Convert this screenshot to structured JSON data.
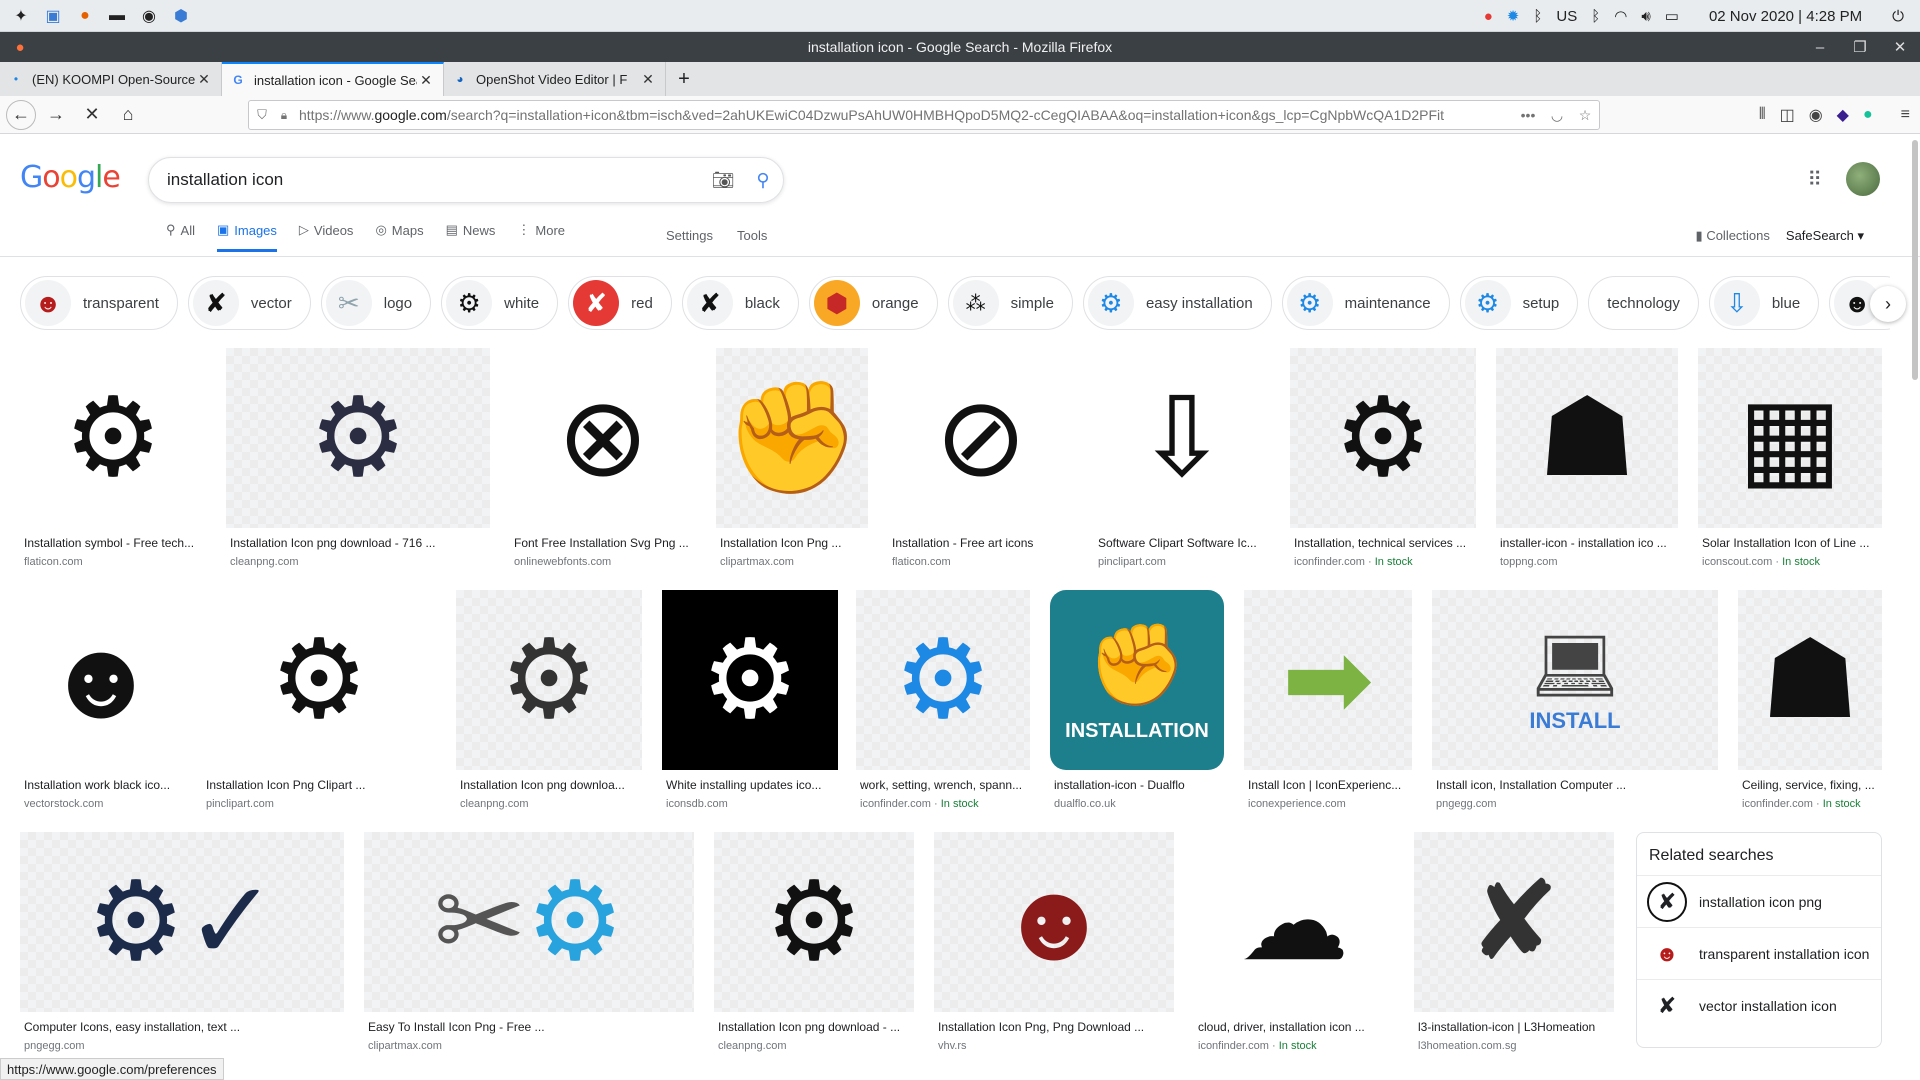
{
  "os": {
    "keyboard": "US",
    "datetime": "02 Nov 2020 | 4:28 PM"
  },
  "window": {
    "title": "installation icon - Google Search - Mozilla Firefox"
  },
  "tabs": [
    {
      "title": "(EN) KOOMPI Open-Source",
      "close": "✕"
    },
    {
      "title": "installation icon - Google Search",
      "close": "✕"
    },
    {
      "title": "OpenShot Video Editor | F",
      "close": "✕"
    }
  ],
  "url": {
    "prefix": "https://www.",
    "domain": "google.com",
    "rest": "/search?q=installation+icon&tbm=isch&ved=2ahUKEwiC04DzwuPsAhUW0HMBHQpoD5MQ2-cCegQIABAA&oq=installation+icon&gs_lcp=CgNpbWcQA1D2PFit"
  },
  "google": {
    "logo": [
      "G",
      "o",
      "o",
      "g",
      "l",
      "e"
    ],
    "logo_colors": [
      "#4285f4",
      "#ea4335",
      "#fbbc05",
      "#4285f4",
      "#34a853",
      "#ea4335"
    ],
    "query": "installation icon",
    "nav": [
      "All",
      "Images",
      "Videos",
      "Maps",
      "News",
      "More"
    ],
    "settings": "Settings",
    "tools": "Tools",
    "collections": "Collections",
    "safesearch": "SafeSearch"
  },
  "chips": [
    {
      "label": "transparent",
      "icon": "worker-icon"
    },
    {
      "label": "vector",
      "icon": "tools-icon"
    },
    {
      "label": "logo",
      "icon": "tools-icon"
    },
    {
      "label": "white",
      "icon": "gear-icon"
    },
    {
      "label": "red",
      "icon": "tools-icon"
    },
    {
      "label": "black",
      "icon": "tools-icon"
    },
    {
      "label": "orange",
      "icon": "box-icon"
    },
    {
      "label": "simple",
      "icon": "grid-icon"
    },
    {
      "label": "easy installation",
      "icon": "gear-icon"
    },
    {
      "label": "maintenance",
      "icon": "gear-icon"
    },
    {
      "label": "setup",
      "icon": "gear-icon"
    },
    {
      "label": "technology",
      "icon": ""
    },
    {
      "label": "blue",
      "icon": "download-icon"
    }
  ],
  "results_row1": [
    {
      "caption": "Installation symbol - Free tech...",
      "source": "flaticon.com",
      "stock": ""
    },
    {
      "caption": "Installation Icon png download - 716 ...",
      "source": "cleanpng.com",
      "stock": ""
    },
    {
      "caption": "Font Free Installation Svg Png ...",
      "source": "onlinewebfonts.com",
      "stock": ""
    },
    {
      "caption": "Installation Icon Png ...",
      "source": "clipartmax.com",
      "stock": ""
    },
    {
      "caption": "Installation - Free art icons",
      "source": "flaticon.com",
      "stock": ""
    },
    {
      "caption": "Software Clipart Software Ic...",
      "source": "pinclipart.com",
      "stock": ""
    },
    {
      "caption": "Installation, technical services ...",
      "source": "iconfinder.com",
      "stock": "In stock"
    },
    {
      "caption": "installer-icon - installation ico ...",
      "source": "toppng.com",
      "stock": ""
    },
    {
      "caption": "Solar Installation Icon of Line ...",
      "source": "iconscout.com",
      "stock": "In stock"
    }
  ],
  "results_row2": [
    {
      "caption": "Installation work black ico...",
      "source": "vectorstock.com",
      "stock": ""
    },
    {
      "caption": "Installation Icon Png Clipart ...",
      "source": "pinclipart.com",
      "stock": ""
    },
    {
      "caption": "Installation Icon png downloa...",
      "source": "cleanpng.com",
      "stock": ""
    },
    {
      "caption": "White installing updates ico...",
      "source": "iconsdb.com",
      "stock": ""
    },
    {
      "caption": "work, setting, wrench, spann...",
      "source": "iconfinder.com",
      "stock": "In stock"
    },
    {
      "caption": "installation-icon - Dualflo",
      "source": "dualflo.co.uk",
      "stock": ""
    },
    {
      "caption": "Install Icon | IconExperienc...",
      "source": "iconexperience.com",
      "stock": ""
    },
    {
      "caption": "Install icon, Installation Computer ...",
      "source": "pngegg.com",
      "stock": ""
    },
    {
      "caption": "Ceiling, service, fixing, ...",
      "source": "iconfinder.com",
      "stock": "In stock"
    }
  ],
  "results_row3": [
    {
      "caption": "Computer Icons, easy installation, text ...",
      "source": "pngegg.com",
      "stock": ""
    },
    {
      "caption": "Easy To Install Icon Png - Free ...",
      "source": "clipartmax.com",
      "stock": ""
    },
    {
      "caption": "Installation Icon png download - ...",
      "source": "cleanpng.com",
      "stock": ""
    },
    {
      "caption": "Installation Icon Png, Png Download ...",
      "source": "vhv.rs",
      "stock": ""
    },
    {
      "caption": "cloud, driver, installation icon ...",
      "source": "iconfinder.com",
      "stock": "In stock"
    },
    {
      "caption": "l3-installation-icon | L3Homeation",
      "source": "l3homeation.com.sg",
      "stock": ""
    }
  ],
  "thumb_texts": {
    "install": "INSTALL",
    "installation": "INSTALLATION"
  },
  "related": {
    "title": "Related searches",
    "items": [
      "installation icon png",
      "transparent installation icon",
      "vector installation icon"
    ]
  },
  "status_url": "https://www.google.com/preferences"
}
